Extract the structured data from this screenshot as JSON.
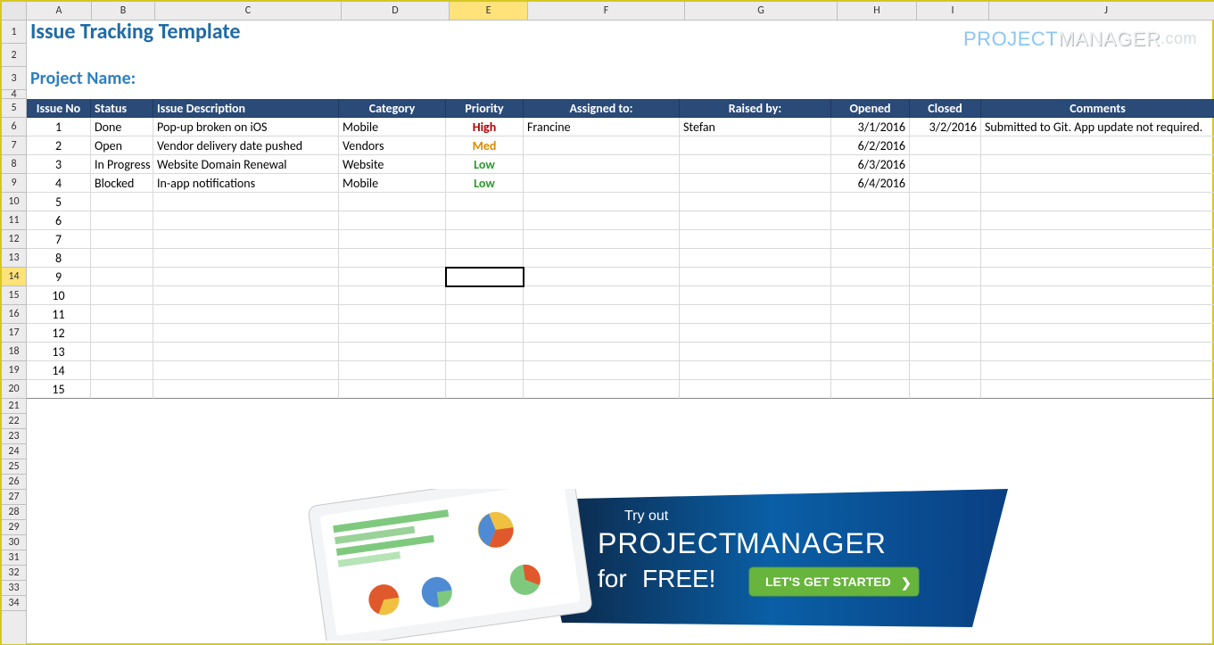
{
  "columns": {
    "letters": [
      "A",
      "B",
      "C",
      "D",
      "E",
      "F",
      "G",
      "H",
      "I",
      "J"
    ],
    "selected": "E"
  },
  "rowheads": {
    "total": 34,
    "tall": [
      1,
      2,
      3
    ],
    "short": [
      4
    ],
    "low_start": 21,
    "selected": 14
  },
  "title": {
    "main": "Issue Tracking Template",
    "sub": "Project Name:"
  },
  "logo": {
    "part1": "PROJECT",
    "part2": "MANAGER",
    "part3": ".com"
  },
  "table": {
    "headers": {
      "issue_no": "Issue No",
      "status": "Status",
      "description": "Issue Description",
      "category": "Category",
      "priority": "Priority",
      "assigned": "Assigned to:",
      "raised": "Raised by:",
      "opened": "Opened",
      "closed": "Closed",
      "comments": "Comments"
    },
    "rows": [
      {
        "no": "1",
        "status": "Done",
        "desc": "Pop-up broken on iOS",
        "cat": "Mobile",
        "pri": "High",
        "assigned": "Francine",
        "raised": "Stefan",
        "opened": "3/1/2016",
        "closed": "3/2/2016",
        "comments": "Submitted to Git. App update not required."
      },
      {
        "no": "2",
        "status": "Open",
        "desc": "Vendor delivery date pushed",
        "cat": "Vendors",
        "pri": "Med",
        "assigned": "",
        "raised": "",
        "opened": "6/2/2016",
        "closed": "",
        "comments": ""
      },
      {
        "no": "3",
        "status": "In Progress",
        "desc": "Website Domain Renewal",
        "cat": "Website",
        "pri": "Low",
        "assigned": "",
        "raised": "",
        "opened": "6/3/2016",
        "closed": "",
        "comments": ""
      },
      {
        "no": "4",
        "status": "Blocked",
        "desc": "In-app notifications",
        "cat": "Mobile",
        "pri": "Low",
        "assigned": "",
        "raised": "",
        "opened": "6/4/2016",
        "closed": "",
        "comments": ""
      },
      {
        "no": "5",
        "status": "",
        "desc": "",
        "cat": "",
        "pri": "",
        "assigned": "",
        "raised": "",
        "opened": "",
        "closed": "",
        "comments": ""
      },
      {
        "no": "6",
        "status": "",
        "desc": "",
        "cat": "",
        "pri": "",
        "assigned": "",
        "raised": "",
        "opened": "",
        "closed": "",
        "comments": ""
      },
      {
        "no": "7",
        "status": "",
        "desc": "",
        "cat": "",
        "pri": "",
        "assigned": "",
        "raised": "",
        "opened": "",
        "closed": "",
        "comments": ""
      },
      {
        "no": "8",
        "status": "",
        "desc": "",
        "cat": "",
        "pri": "",
        "assigned": "",
        "raised": "",
        "opened": "",
        "closed": "",
        "comments": ""
      },
      {
        "no": "9",
        "status": "",
        "desc": "",
        "cat": "",
        "pri": "",
        "assigned": "",
        "raised": "",
        "opened": "",
        "closed": "",
        "comments": ""
      },
      {
        "no": "10",
        "status": "",
        "desc": "",
        "cat": "",
        "pri": "",
        "assigned": "",
        "raised": "",
        "opened": "",
        "closed": "",
        "comments": ""
      },
      {
        "no": "11",
        "status": "",
        "desc": "",
        "cat": "",
        "pri": "",
        "assigned": "",
        "raised": "",
        "opened": "",
        "closed": "",
        "comments": ""
      },
      {
        "no": "12",
        "status": "",
        "desc": "",
        "cat": "",
        "pri": "",
        "assigned": "",
        "raised": "",
        "opened": "",
        "closed": "",
        "comments": ""
      },
      {
        "no": "13",
        "status": "",
        "desc": "",
        "cat": "",
        "pri": "",
        "assigned": "",
        "raised": "",
        "opened": "",
        "closed": "",
        "comments": ""
      },
      {
        "no": "14",
        "status": "",
        "desc": "",
        "cat": "",
        "pri": "",
        "assigned": "",
        "raised": "",
        "opened": "",
        "closed": "",
        "comments": ""
      },
      {
        "no": "15",
        "status": "",
        "desc": "",
        "cat": "",
        "pri": "",
        "assigned": "",
        "raised": "",
        "opened": "",
        "closed": "",
        "comments": ""
      }
    ]
  },
  "banner": {
    "tryout": "Try out",
    "line1a": "PROJECT",
    "line1b": "MANAGER",
    "line2a": "for",
    "line2b": "FREE!",
    "cta": "LET'S GET STARTED",
    "arrow": "❯"
  },
  "selection": {
    "cell": "E14",
    "row": 14,
    "col": "E"
  }
}
